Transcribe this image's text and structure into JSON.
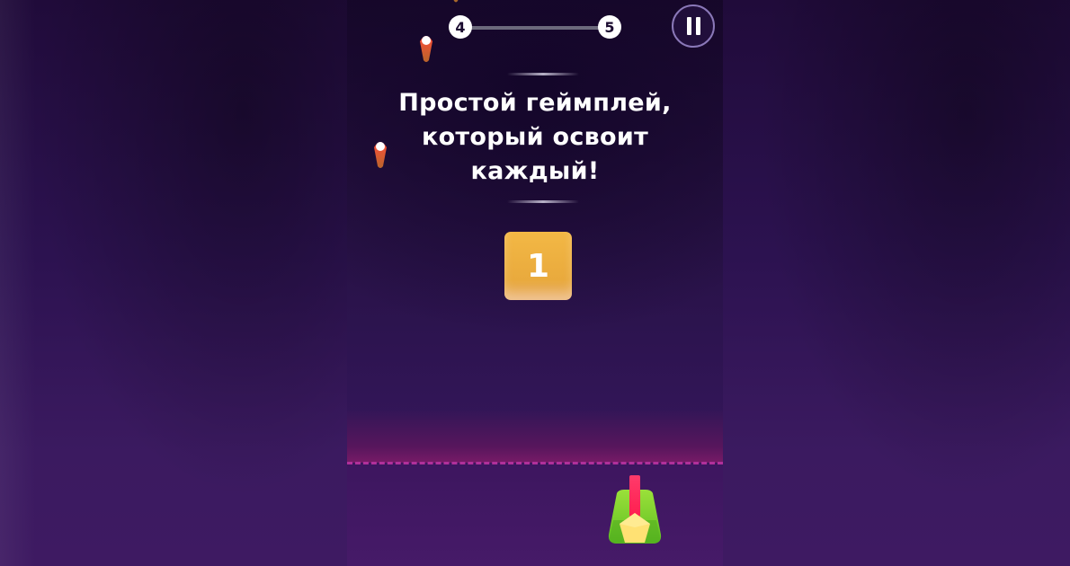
{
  "game": {
    "progress": {
      "current_level": "4",
      "next_level": "5",
      "fraction": 0.04
    },
    "headline_lines": [
      "Простой геймплей,",
      "который освоит",
      "каждый!"
    ],
    "block_value": "1",
    "icons": {
      "pause": "pause-icon",
      "cannon": "cannon-icon",
      "bullet": "bullet-icon"
    },
    "colors": {
      "background": "#2d1450",
      "block": "#f0b342",
      "dashed_line": "#b0309a",
      "cannon_body": "#7fd12e",
      "cannon_barrel": "#ff2a5a",
      "cannon_tip": "#ffe173"
    }
  }
}
